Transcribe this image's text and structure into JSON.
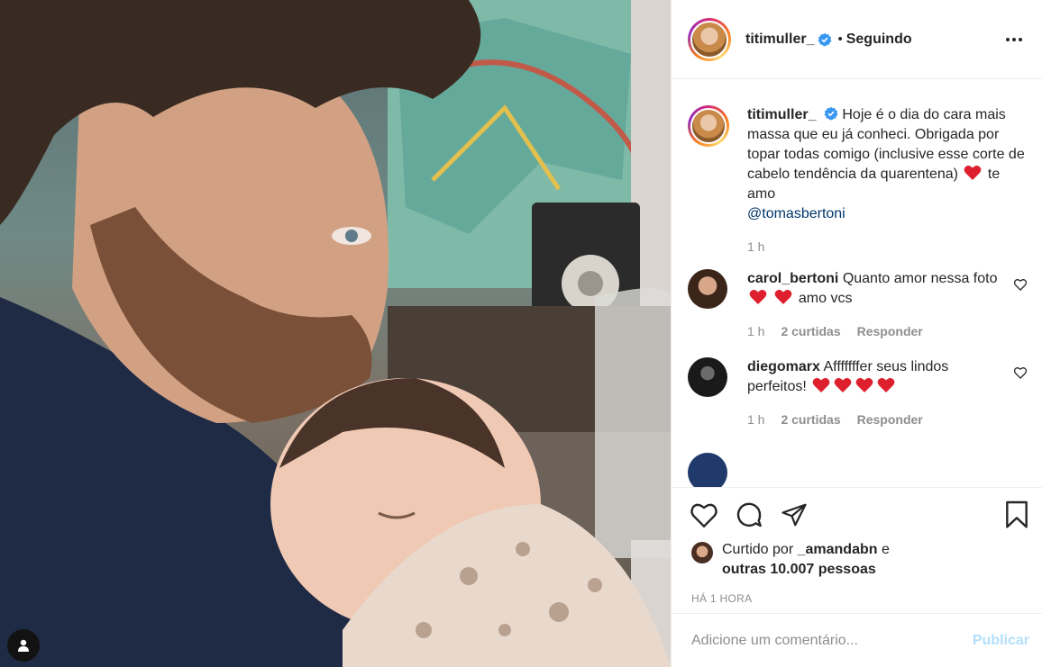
{
  "post_image": {
    "alt": ""
  },
  "header": {
    "username": "titimuller_",
    "separator": "•",
    "follow_status": "Seguindo"
  },
  "caption": {
    "username": "titimuller_",
    "text_before_emoji": "Hoje é o dia do cara mais massa que eu já conheci. Obrigada por topar todas comigo (inclusive esse corte de cabelo tendência da quarentena)",
    "text_after_emoji": "te amo",
    "mention": "@tomasbertoni",
    "time": "1 h"
  },
  "comments": [
    {
      "username": "carol_bertoni",
      "text_a": "Quanto amor nessa foto",
      "text_b": "amo vcs",
      "time": "1 h",
      "likes": "2 curtidas",
      "reply": "Responder"
    },
    {
      "username": "diegomarx",
      "text_a": "Afffffffer seus lindos perfeitos!",
      "time": "1 h",
      "likes": "2 curtidas",
      "reply": "Responder"
    }
  ],
  "likes": {
    "prefix": "Curtido por",
    "user": "_amandabn",
    "conj": "e",
    "others": "outras 10.007 pessoas"
  },
  "timestamp": "HÁ 1 HORA",
  "add_comment": {
    "placeholder": "Adicione um comentário...",
    "publish_label": "Publicar"
  },
  "colors": {
    "verified": "#3897f0",
    "heart": "#ed4956",
    "mention": "#00376b",
    "publish_disabled": "#b2dffc",
    "meta": "#8e8e8e"
  },
  "icons": [
    "user-tag-icon",
    "verified-badge-icon",
    "more-options-icon",
    "heart-icon",
    "comment-icon",
    "share-icon",
    "bookmark-icon",
    "red-heart-emoji-icon"
  ]
}
